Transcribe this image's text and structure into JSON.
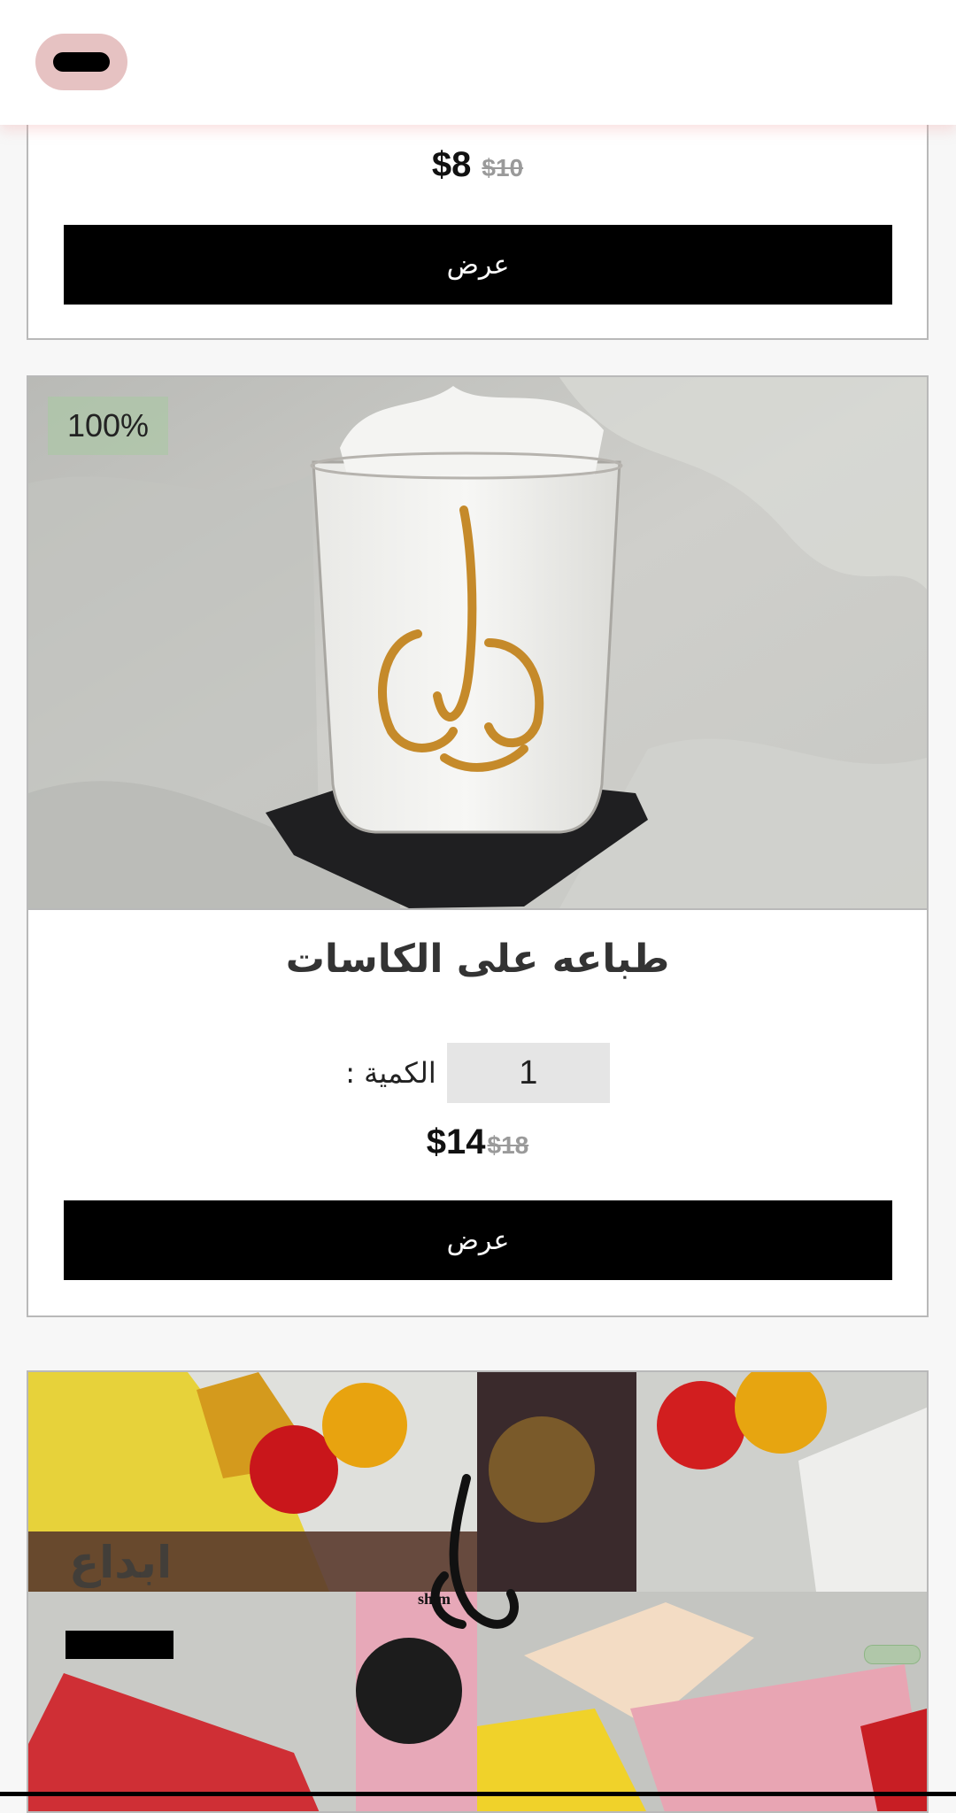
{
  "header": {
    "menu_icon": "menu-icon"
  },
  "products": [
    {
      "price": "$8",
      "old_price": "$10",
      "view_label": "عرض"
    },
    {
      "badge": "100%",
      "title": "طباعه على الكاسات",
      "qty_label": ": الكمية",
      "qty_value": "1",
      "price": "$14",
      "old_price": "$18",
      "view_label": "عرض"
    },
    {
      "collage_text": "ابداع",
      "logo_text": "shim"
    }
  ],
  "colors": {
    "accent_menu": "#e6c2c2",
    "button": "#000000",
    "badge": "#aac8a5"
  }
}
